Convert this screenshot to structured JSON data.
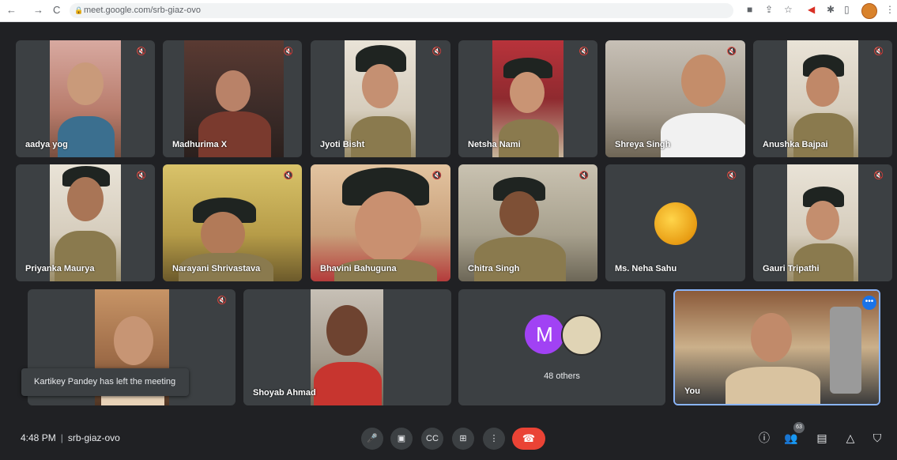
{
  "browser": {
    "url": "meet.google.com/srb-giaz-ovo",
    "nav": {
      "back": "←",
      "forward": "→",
      "reload": "C"
    }
  },
  "participants": [
    {
      "name": "aadya yog"
    },
    {
      "name": "Madhurima X"
    },
    {
      "name": "Jyoti Bisht"
    },
    {
      "name": "Netsha Nami"
    },
    {
      "name": "Shreya Singh"
    },
    {
      "name": "Anushka Bajpai"
    },
    {
      "name": "Priyanka Maurya"
    },
    {
      "name": "Narayani Shrivastava"
    },
    {
      "name": "Bhavini Bahuguna"
    },
    {
      "name": "Chitra Singh"
    },
    {
      "name": "Ms. Neha Sahu"
    },
    {
      "name": "Gauri Tripathi"
    },
    {
      "name": "Shoyab Ahmad"
    },
    {
      "name": "You"
    }
  ],
  "others": {
    "initial": "M",
    "label": "48 others"
  },
  "toast": "Kartikey Pandey has left the meeting",
  "bottom_bar": {
    "time": "4:48 PM",
    "meeting_code": "srb-giaz-ovo",
    "people_count": "63"
  },
  "colors": {
    "end_call": "#ea4335",
    "accent": "#1a73e8",
    "avatar_m": "#a142f4"
  }
}
